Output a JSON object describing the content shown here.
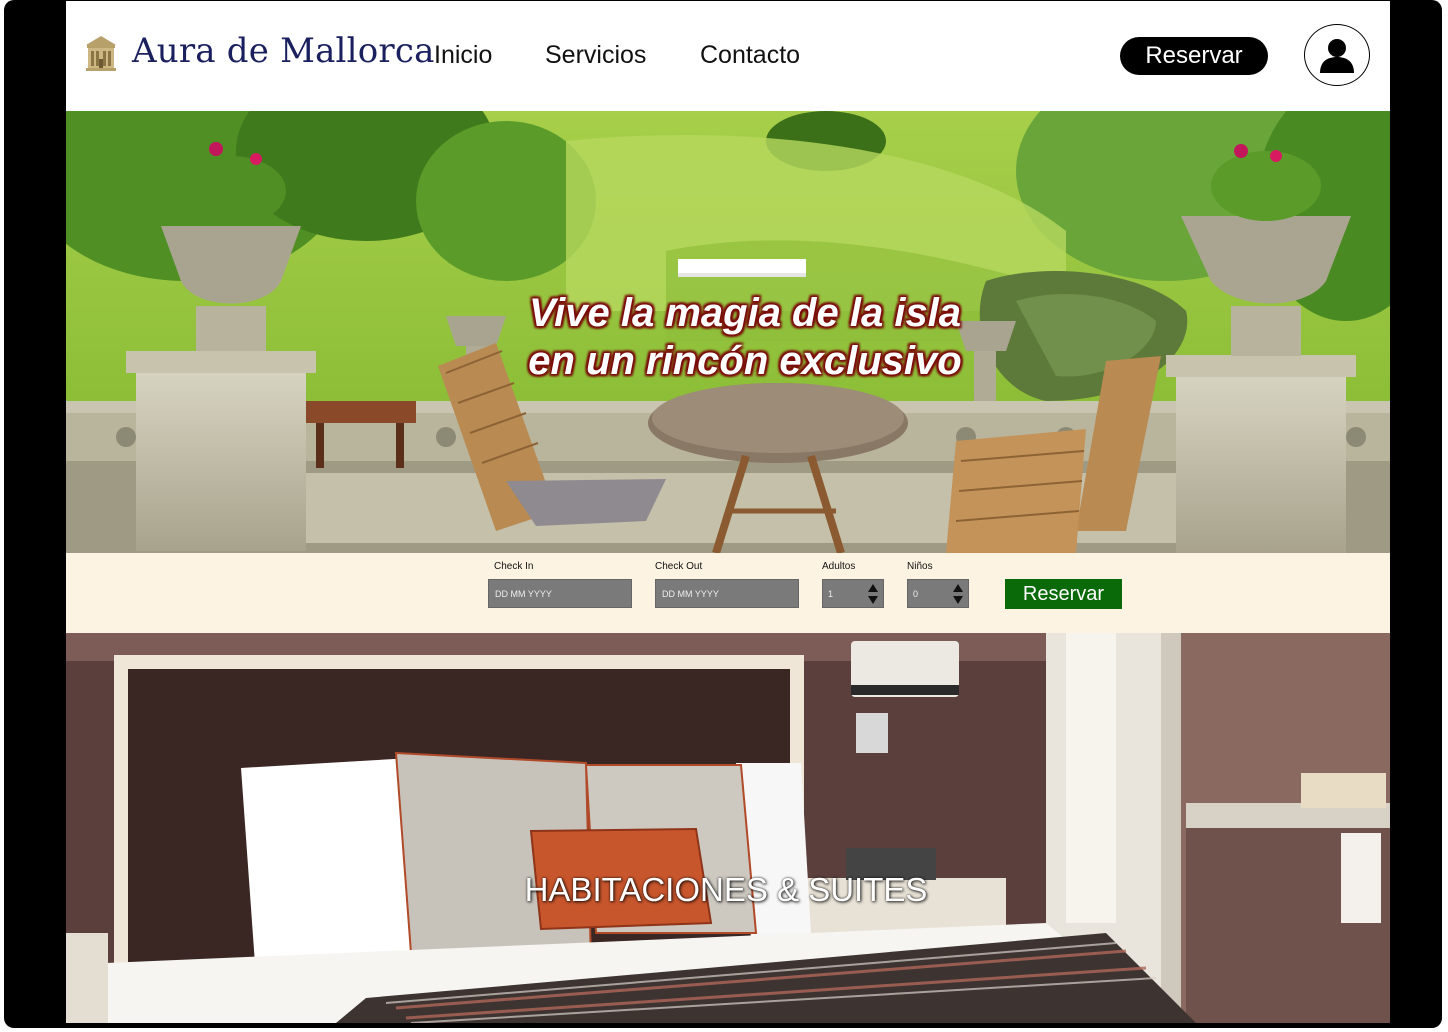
{
  "header": {
    "brand": "Aura de Mallorca",
    "logo_icon": "hotel-building-icon",
    "nav": [
      {
        "label": "Inicio"
      },
      {
        "label": "Servicios"
      },
      {
        "label": "Contacto"
      }
    ],
    "reserve_label": "Reservar",
    "user_icon": "user-account-icon"
  },
  "hero": {
    "headline_line1": "Vive la magia de la isla",
    "headline_line2": "en un rincón exclusivo"
  },
  "booking": {
    "checkin_label": "Check In",
    "checkin_placeholder": "DD MM YYYY",
    "checkout_label": "Check Out",
    "checkout_placeholder": "DD MM YYYY",
    "adults_label": "Adultos",
    "adults_value": "1",
    "children_label": "Niños",
    "children_value": "0",
    "reserve_label": "Reservar"
  },
  "rooms": {
    "title": "HABITACIONES & SUITES"
  },
  "colors": {
    "brand_navy": "#1a1f5e",
    "logo_gold": "#b8a06a",
    "booking_bg": "#fdf3e2",
    "reserve_green": "#0a6a0a",
    "headline_outline": "#7a0a0a"
  }
}
